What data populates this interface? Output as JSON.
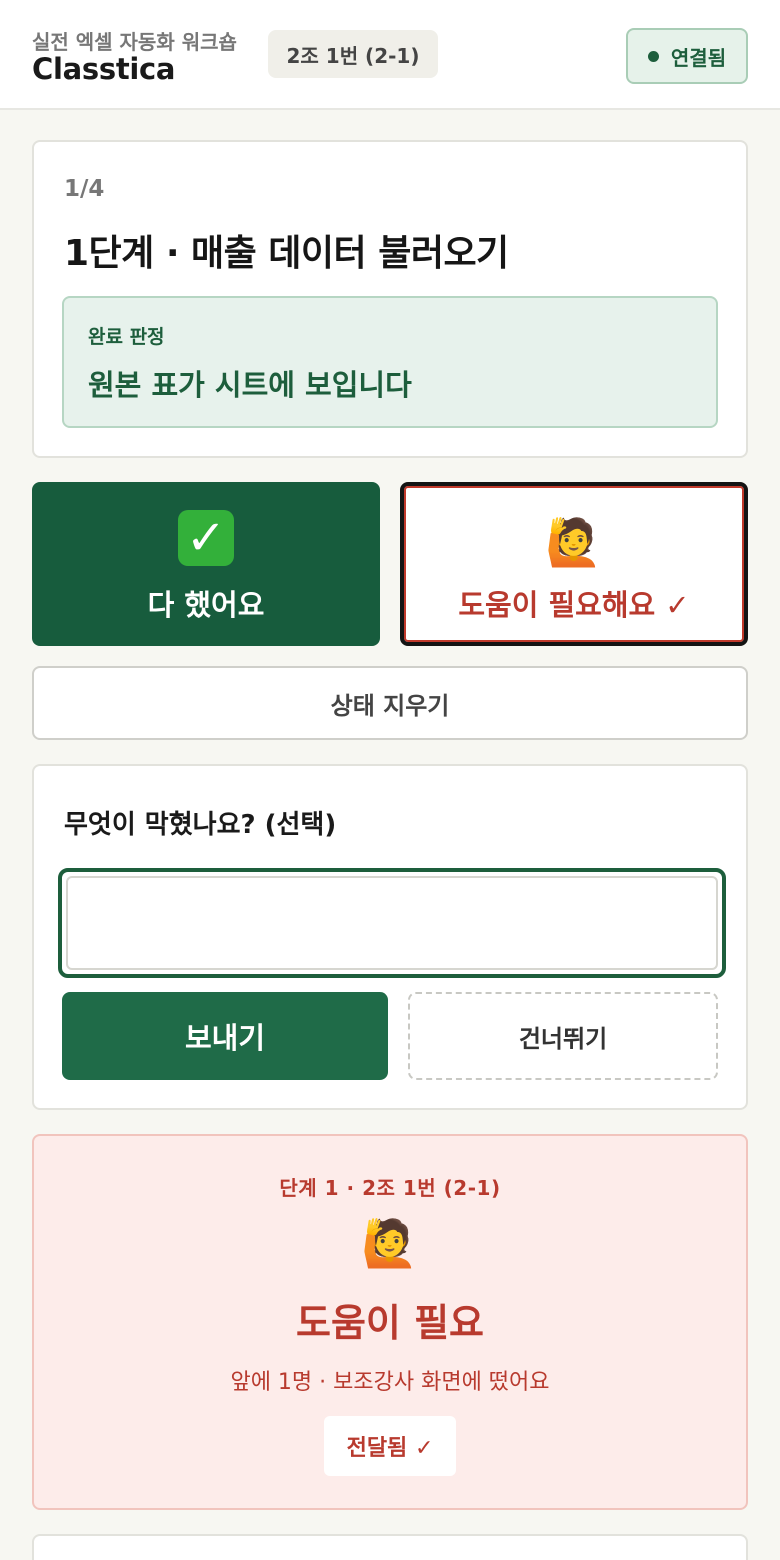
{
  "header": {
    "subtitle": "실전 엑셀 자동화 워크숍",
    "brand": "Classtica",
    "group_badge": "2조 1번 (2-1)",
    "connection_status": "연결됨"
  },
  "step": {
    "count": "1/4",
    "title": "1단계 · 매출 데이터 불러오기",
    "criteria_label": "완료 판정",
    "criteria_value": "원본 표가 시트에 보입니다"
  },
  "actions": {
    "done_emoji": "✓",
    "done_label": "다 했어요",
    "help_emoji": "🙋",
    "help_label": "도움이 필요해요 ✓",
    "clear_label": "상태 지우기"
  },
  "form": {
    "question": "무엇이 막혔나요? (선택)",
    "input_value": "",
    "send_label": "보내기",
    "skip_label": "건너뛰기"
  },
  "alert": {
    "meta": "단계 1 · 2조 1번 (2-1)",
    "emoji": "🙋",
    "title": "도움이 필요",
    "subtitle": "앞에 1명 · 보조강사 화면에 떴어요",
    "delivered_label": "전달됨 ✓"
  },
  "colors": {
    "primary": "#175c3d",
    "accent_red": "#b83a2e",
    "alert_bg": "#fdecea",
    "criteria_bg": "#e7f2ec"
  }
}
